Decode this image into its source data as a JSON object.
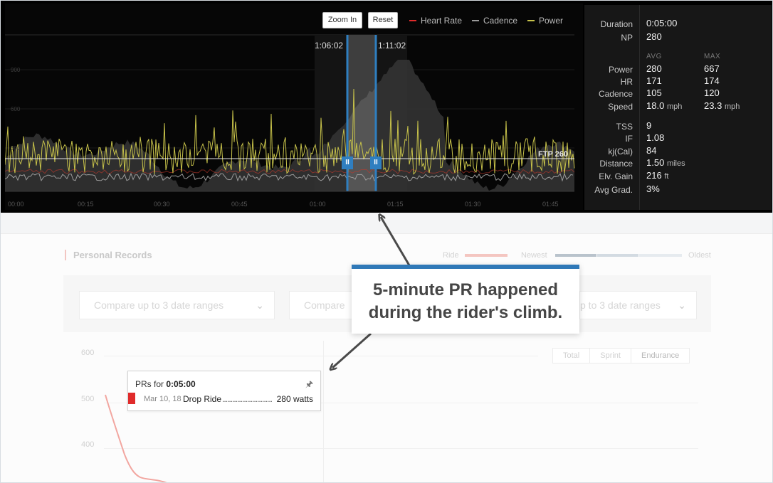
{
  "ride_chart": {
    "buttons": {
      "zoom_in": "Zoom In",
      "reset": "Reset"
    },
    "legend": [
      {
        "label": "Heart Rate",
        "color": "#e02b2b"
      },
      {
        "label": "Cadence",
        "color": "#9b9b9b"
      },
      {
        "label": "Power",
        "color": "#c7c24a"
      }
    ],
    "selection": {
      "start": "1:06:02",
      "end": "1:11:02",
      "handle_glyph": "II"
    },
    "ftp_label": "FTP 260",
    "y_ticks": [
      "900",
      "600",
      "300"
    ],
    "x_ticks": [
      "00:00",
      "00:15",
      "00:30",
      "00:45",
      "01:00",
      "01:15",
      "01:30",
      "01:45"
    ],
    "colors": {
      "power": "#c7c24a",
      "heart_rate": "#e02b2b",
      "cadence": "#9b9b9b",
      "elevation": "#3a3a3a",
      "selection": "#2f7fc0"
    }
  },
  "stats": {
    "duration": {
      "label": "Duration",
      "value": "0:05:00"
    },
    "np": {
      "label": "NP",
      "value": "280"
    },
    "avg_header": "AVG",
    "max_header": "MAX",
    "power": {
      "label": "Power",
      "avg": "280",
      "max": "667"
    },
    "hr": {
      "label": "HR",
      "avg": "171",
      "max": "174"
    },
    "cadence": {
      "label": "Cadence",
      "avg": "105",
      "max": "120"
    },
    "speed": {
      "label": "Speed",
      "avg": "18.0",
      "max": "23.3",
      "unit": "mph"
    },
    "tss": {
      "label": "TSS",
      "value": "9"
    },
    "if": {
      "label": "IF",
      "value": "1.08"
    },
    "kj": {
      "label": "kj(Cal)",
      "value": "84"
    },
    "distance": {
      "label": "Distance",
      "value": "1.50",
      "unit": "miles"
    },
    "elev_gain": {
      "label": "Elv. Gain",
      "value": "216",
      "unit": "ft"
    },
    "avg_grad": {
      "label": "Avg Grad.",
      "value": "3%"
    }
  },
  "personal_records": {
    "title": "Personal Records",
    "recency": {
      "ride": "Ride",
      "newest": "Newest",
      "oldest": "Oldest"
    },
    "compare_placeholder": "Compare up to 3 date ranges",
    "compare_placeholder_partial_2": "Compare u",
    "compare_placeholder_partial_3": "p to 3 date ranges",
    "filters": [
      "Total",
      "Sprint",
      "Endurance"
    ],
    "y_ticks": [
      "600",
      "500",
      "400"
    ],
    "tooltip": {
      "prefix": "PRs for",
      "duration": "0:05:00",
      "date": "Mar 10, 18",
      "ride_name": "Drop Ride",
      "dots": "..............................",
      "value": "280 watts",
      "color": "#e02b2b"
    }
  },
  "callout": {
    "line1": "5-minute PR happened",
    "line2": "during the rider's climb.",
    "accent": "#2f78b7"
  }
}
